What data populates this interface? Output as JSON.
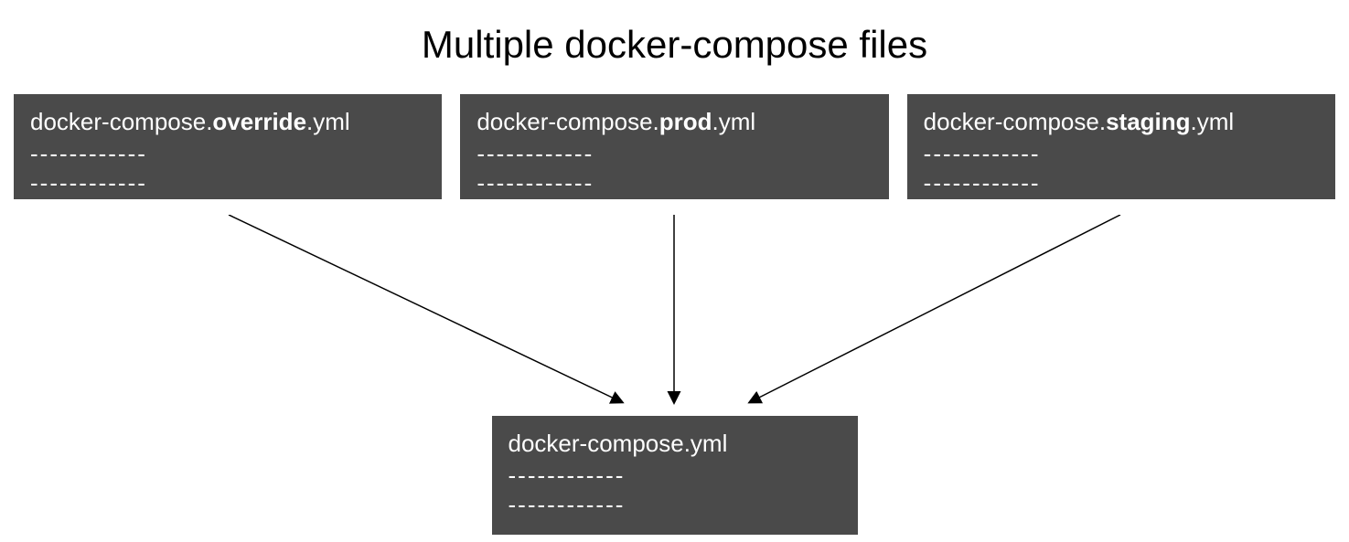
{
  "title": "Multiple docker-compose files",
  "topFiles": [
    {
      "prefix": "docker-compose.",
      "bold": "override",
      "suffix": ".yml"
    },
    {
      "prefix": "docker-compose.",
      "bold": "prod",
      "suffix": ".yml"
    },
    {
      "prefix": "docker-compose.",
      "bold": "staging",
      "suffix": ".yml"
    }
  ],
  "bottomFile": {
    "label": "docker-compose.yml"
  },
  "dashLine": "------------"
}
